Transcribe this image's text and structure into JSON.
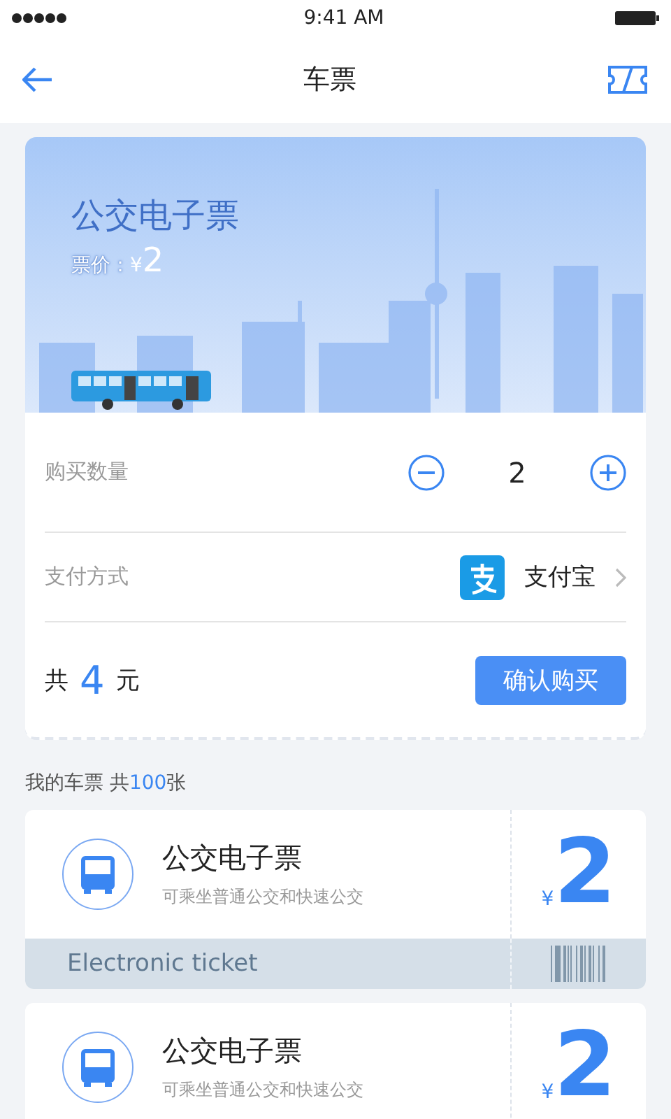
{
  "status_bar": {
    "time": "9:41 AM"
  },
  "nav": {
    "title": "车票"
  },
  "hero": {
    "title": "公交电子票",
    "price_label": "票价：",
    "currency": "¥",
    "price": "2"
  },
  "purchase": {
    "quantity_label": "购买数量",
    "quantity": "2",
    "payment_label": "支付方式",
    "payment_method": "支付宝",
    "total_prefix": "共",
    "total_amount": "4",
    "total_suffix": "元",
    "confirm": "确认购买"
  },
  "my_tickets": {
    "title": "我的车票",
    "total_prefix": "共",
    "total_count": "100",
    "total_suffix": "张"
  },
  "tickets": [
    {
      "name": "公交电子票",
      "description": "可乘坐普通公交和快速公交",
      "currency": "¥",
      "price": "2",
      "footer": "Electronic ticket"
    },
    {
      "name": "公交电子票",
      "description": "可乘坐普通公交和快速公交",
      "currency": "¥",
      "price": "2"
    }
  ]
}
